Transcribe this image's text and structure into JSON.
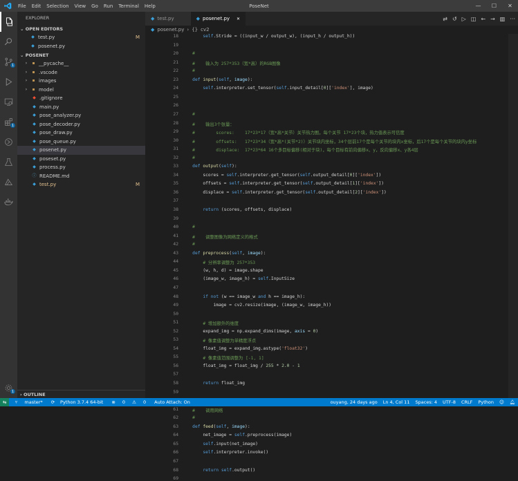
{
  "window": {
    "title": "PoseNet"
  },
  "menu": [
    "File",
    "Edit",
    "Selection",
    "View",
    "Go",
    "Run",
    "Terminal",
    "Help"
  ],
  "sidebar": {
    "title": "EXPLORER",
    "open_editors_label": "OPEN EDITORS",
    "open_editors": [
      {
        "name": "test.py",
        "mark": "M"
      },
      {
        "name": "posenet.py",
        "mark": ""
      }
    ],
    "project_label": "POSENET",
    "files": [
      {
        "name": "__pycache__",
        "type": "folder",
        "mark": ""
      },
      {
        "name": ".vscode",
        "type": "folder",
        "mark": ""
      },
      {
        "name": "images",
        "type": "folder",
        "mark": ""
      },
      {
        "name": "model",
        "type": "folder",
        "mark": ""
      },
      {
        "name": ".gitignore",
        "type": "git",
        "mark": ""
      },
      {
        "name": "main.py",
        "type": "py",
        "mark": ""
      },
      {
        "name": "pose_analyzer.py",
        "type": "py",
        "mark": ""
      },
      {
        "name": "pose_decoder.py",
        "type": "py",
        "mark": ""
      },
      {
        "name": "pose_draw.py",
        "type": "py",
        "mark": ""
      },
      {
        "name": "pose_queue.py",
        "type": "py",
        "mark": ""
      },
      {
        "name": "posenet.py",
        "type": "py",
        "mark": "",
        "selected": true
      },
      {
        "name": "poseset.py",
        "type": "py",
        "mark": ""
      },
      {
        "name": "process.py",
        "type": "py",
        "mark": ""
      },
      {
        "name": "README.md",
        "type": "md",
        "mark": ""
      },
      {
        "name": "test.py",
        "type": "py",
        "mark": "M"
      }
    ],
    "outline_label": "OUTLINE"
  },
  "tabs": [
    {
      "name": "test.py",
      "active": false
    },
    {
      "name": "posenet.py",
      "active": true
    }
  ],
  "breadcrumb": {
    "file": "posenet.py",
    "sep": "›",
    "symbol": "cv2"
  },
  "code": [
    {
      "n": "18",
      "h": "        <span class=\"sf\">self</span>.Stride = ((input_w / output_w), (input_h / output_h))"
    },
    {
      "n": "19",
      "h": ""
    },
    {
      "n": "20",
      "h": "    <span class=\"c\">#</span>"
    },
    {
      "n": "21",
      "h": "    <span class=\"c\">#    输入为 257*353（宽*高）的RGB图像</span>"
    },
    {
      "n": "22",
      "h": "    <span class=\"c\">#</span>"
    },
    {
      "n": "23",
      "h": "    <span class=\"k\">def</span> <span class=\"f\">input</span>(<span class=\"sf\">self</span>, <span class=\"v\">image</span>):"
    },
    {
      "n": "24",
      "h": "        <span class=\"sf\">self</span>.interpreter.set_tensor(<span class=\"sf\">self</span>.input_detail[<span class=\"n\">0</span>][<span class=\"s\">'index'</span>], image)"
    },
    {
      "n": "25",
      "h": ""
    },
    {
      "n": "26",
      "h": ""
    },
    {
      "n": "27",
      "h": "    <span class=\"c\">#</span>"
    },
    {
      "n": "28",
      "h": "    <span class=\"c\">#    输出3个张量：</span>"
    },
    {
      "n": "29",
      "h": "    <span class=\"c\">#        scores:    17*23*17（宽*高*关节）关节热力图，每个关节 17*23个块，热力值表示可信度</span>"
    },
    {
      "n": "30",
      "h": "    <span class=\"c\">#        offsets:   17*23*34（宽*高*(关节*2)）关节块内坐标，34个层前17个是每个关节的块内x坐标，后17个是每个关节的块内y坐标</span>"
    },
    {
      "n": "31",
      "h": "    <span class=\"c\">#        displace:  17*23*64 16个多目标偏移(相对于块)，每个目标有前向偏移x、y，反向偏移x、y各4层</span>"
    },
    {
      "n": "32",
      "h": "    <span class=\"c\">#</span>"
    },
    {
      "n": "33",
      "h": "    <span class=\"k\">def</span> <span class=\"f\">output</span>(<span class=\"sf\">self</span>):"
    },
    {
      "n": "34",
      "h": "        scores = <span class=\"sf\">self</span>.interpreter.get_tensor(<span class=\"sf\">self</span>.output_detail[<span class=\"n\">0</span>][<span class=\"s\">'index'</span>])"
    },
    {
      "n": "35",
      "h": "        offsets = <span class=\"sf\">self</span>.interpreter.get_tensor(<span class=\"sf\">self</span>.output_detail[<span class=\"n\">1</span>][<span class=\"s\">'index'</span>])"
    },
    {
      "n": "36",
      "h": "        displace = <span class=\"sf\">self</span>.interpreter.get_tensor(<span class=\"sf\">self</span>.output_detail[<span class=\"n\">2</span>][<span class=\"s\">'index'</span>])"
    },
    {
      "n": "37",
      "h": ""
    },
    {
      "n": "38",
      "h": "        <span class=\"k\">return</span> (scores, offsets, displace)"
    },
    {
      "n": "39",
      "h": ""
    },
    {
      "n": "40",
      "h": "    <span class=\"c\">#</span>"
    },
    {
      "n": "41",
      "h": "    <span class=\"c\">#    调整图像为网络定义的格式</span>"
    },
    {
      "n": "42",
      "h": "    <span class=\"c\">#</span>"
    },
    {
      "n": "43",
      "h": "    <span class=\"k\">def</span> <span class=\"f\">preprocess</span>(<span class=\"sf\">self</span>, <span class=\"v\">image</span>):"
    },
    {
      "n": "44",
      "h": "        <span class=\"c\"># 分辨率调整为 257*353</span>"
    },
    {
      "n": "45",
      "h": "        (w, h, d) = image.shape"
    },
    {
      "n": "46",
      "h": "        (image_w, image_h) = <span class=\"sf\">self</span>.InputSize"
    },
    {
      "n": "47",
      "h": ""
    },
    {
      "n": "48",
      "h": "        <span class=\"k\">if</span> <span class=\"k\">not</span> (w == image_w <span class=\"k\">and</span> h == image_h):"
    },
    {
      "n": "49",
      "h": "            image = cv2.resize(image, (image_w, image_h))"
    },
    {
      "n": "50",
      "h": ""
    },
    {
      "n": "51",
      "h": "        <span class=\"c\"># 增加额外的维度</span>"
    },
    {
      "n": "52",
      "h": "        expand_img = np.expand_dims(image, <span class=\"v\">axis</span> = <span class=\"n\">0</span>)"
    },
    {
      "n": "53",
      "h": "        <span class=\"c\"># 像素值调整为单精度浮点</span>"
    },
    {
      "n": "54",
      "h": "        float_img = expand_img.astype(<span class=\"s\">'float32'</span>)"
    },
    {
      "n": "55",
      "h": "        <span class=\"c\"># 像素值范围调整为 [-1, 1]</span>"
    },
    {
      "n": "56",
      "h": "        float_img = float_img / <span class=\"n\">255</span> * <span class=\"n\">2.0</span> - <span class=\"n\">1</span>"
    },
    {
      "n": "57",
      "h": ""
    },
    {
      "n": "58",
      "h": "        <span class=\"k\">return</span> float_img"
    },
    {
      "n": "59",
      "h": ""
    },
    {
      "n": "60",
      "h": "    <span class=\"c\">#</span>"
    },
    {
      "n": "61",
      "h": "    <span class=\"c\">#    调用网络</span>"
    },
    {
      "n": "62",
      "h": "    <span class=\"c\">#</span>"
    },
    {
      "n": "63",
      "h": "    <span class=\"k\">def</span> <span class=\"f\">feed</span>(<span class=\"sf\">self</span>, <span class=\"v\">image</span>):"
    },
    {
      "n": "64",
      "h": "        net_image = <span class=\"sf\">self</span>.preprocess(image)"
    },
    {
      "n": "65",
      "h": "        <span class=\"sf\">self</span>.input(net_image)"
    },
    {
      "n": "66",
      "h": "        <span class=\"sf\">self</span>.interpreter.invoke()"
    },
    {
      "n": "67",
      "h": ""
    },
    {
      "n": "68",
      "h": "        <span class=\"k\">return</span> <span class=\"sf\">self</span>.output()"
    },
    {
      "n": "69",
      "h": ""
    }
  ],
  "status": {
    "branch": "master*",
    "python": "Python 3.7.4 64-bit",
    "problems": "0",
    "warnings": "0",
    "auto_attach": "Auto Attach: On",
    "blame": "ouyang, 24 days ago",
    "position": "Ln 4, Col 11",
    "spaces": "Spaces: 4",
    "encoding": "UTF-8",
    "eol": "CRLF",
    "language": "Python"
  },
  "colors": {
    "accent": "#007acc",
    "activity": "#333333",
    "sidebar": "#252526",
    "editor": "#1e1e1e"
  }
}
